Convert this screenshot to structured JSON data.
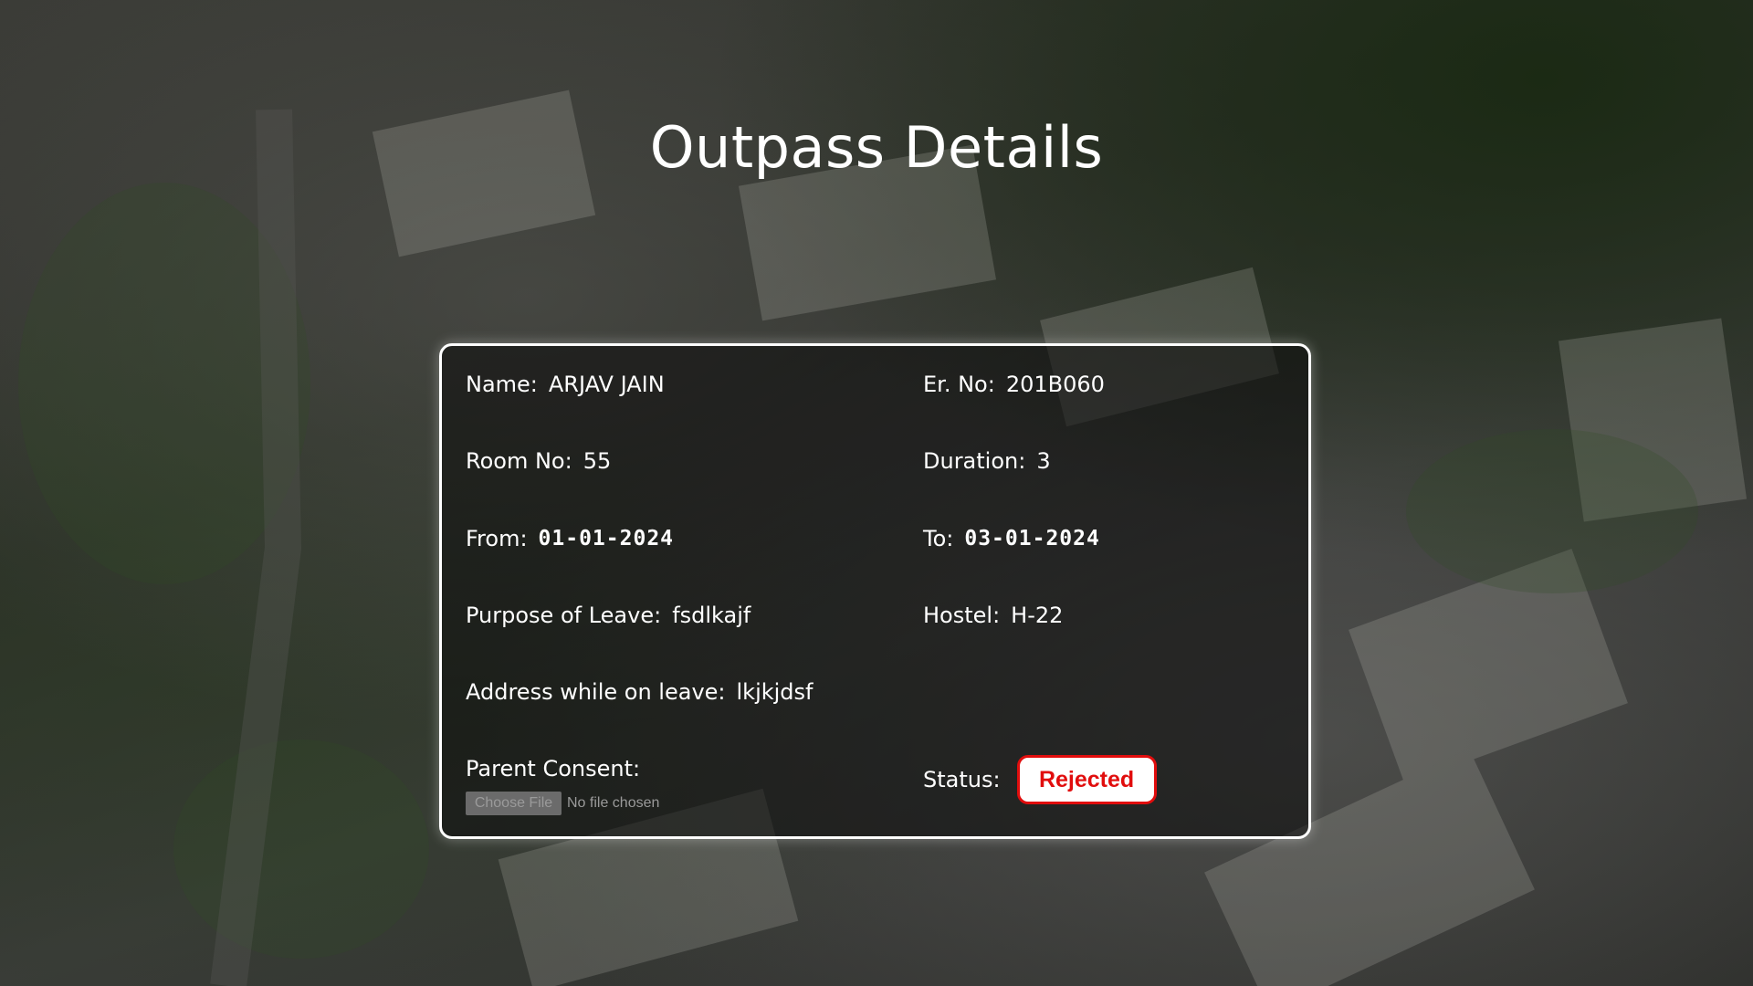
{
  "page": {
    "title": "Outpass Details"
  },
  "details": {
    "name_label": "Name:",
    "name_value": "ARJAV JAIN",
    "er_no_label": "Er. No:",
    "er_no_value": "201B060",
    "room_label": "Room No:",
    "room_value": "55",
    "duration_label": "Duration:",
    "duration_value": "3",
    "from_label": "From:",
    "from_value": "01-01-2024",
    "to_label": "To:",
    "to_value": "03-01-2024",
    "purpose_label": "Purpose of Leave:",
    "purpose_value": "fsdlkajf",
    "hostel_label": "Hostel:",
    "hostel_value": "H-22",
    "address_label": "Address while on leave:",
    "address_value": "lkjkjdsf",
    "consent_label": "Parent Consent:",
    "file_button_label": "Choose File",
    "file_status": "No file chosen",
    "status_label": "Status:",
    "status_value": "Rejected"
  },
  "colors": {
    "status_rejected": "#e10d0d"
  }
}
